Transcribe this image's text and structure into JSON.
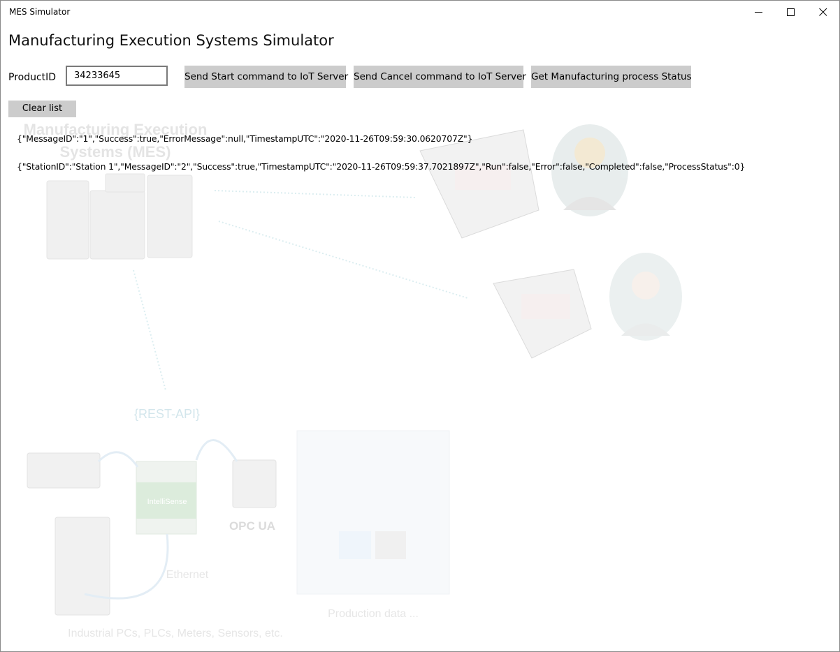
{
  "window": {
    "title": "MES Simulator"
  },
  "controls": {
    "minimize": "minimize-icon",
    "maximize": "maximize-icon",
    "close": "close-icon"
  },
  "header": {
    "title": "Manufacturing Execution Systems Simulator"
  },
  "form": {
    "product_id_label": "ProductID",
    "product_id_value": "34233645",
    "start_button": "Send Start command to IoT Server",
    "cancel_button": "Send Cancel command to IoT Server",
    "status_button": "Get Manufacturing process Status",
    "clear_button": "Clear list"
  },
  "log": [
    "{\"MessageID\":\"1\",\"Success\":true,\"ErrorMessage\":null,\"TimestampUTC\":\"2020-11-26T09:59:30.0620707Z\"}",
    "{\"StationID\":\"Station 1\",\"MessageID\":\"2\",\"Success\":true,\"TimestampUTC\":\"2020-11-26T09:59:37.7021897Z\",\"Run\":false,\"Error\":false,\"Completed\":false,\"ProcessStatus\":0}"
  ],
  "background": {
    "mes_title_line1": "Manufacturing Execution",
    "mes_title_line2": "Systems (MES)",
    "rest_api": "{REST-API}",
    "intellisense": "IntelliSense",
    "opc_ua": "OPC UA",
    "ethernet": "Ethernet",
    "production_data": "Production data ...",
    "devices": "Industrial PCs, PLCs, Meters, Sensors, etc."
  }
}
